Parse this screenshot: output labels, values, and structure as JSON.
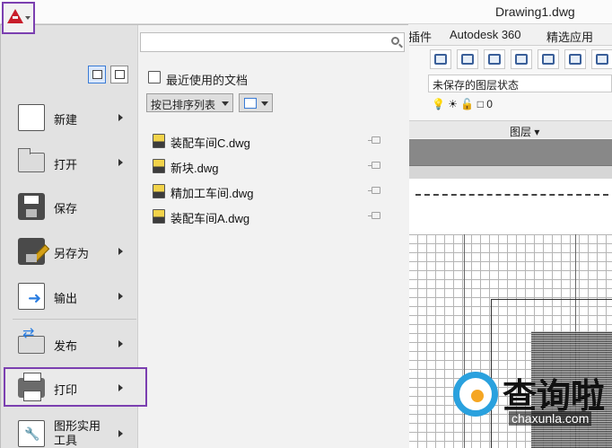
{
  "title_bar": {
    "document_title": "Drawing1.dwg",
    "app_button_icon": "autocad-logo-icon"
  },
  "ribbon": {
    "tabs": [
      "插件",
      "Autodesk 360",
      "精选应用"
    ],
    "layer_state": "未保存的图层状态",
    "layer_value": "0",
    "panel_label": "图层 ▾"
  },
  "menu": {
    "search": {
      "placeholder": ""
    },
    "items": [
      {
        "label": "新建",
        "icon": "new-document-icon",
        "arrow": true
      },
      {
        "label": "打开",
        "icon": "open-folder-icon",
        "arrow": true
      },
      {
        "label": "保存",
        "icon": "save-disk-icon",
        "arrow": false
      },
      {
        "label": "另存为",
        "icon": "save-as-icon",
        "arrow": true
      },
      {
        "label": "输出",
        "icon": "export-icon",
        "arrow": true
      },
      {
        "label": "发布",
        "icon": "publish-icon",
        "arrow": true
      },
      {
        "label": "打印",
        "icon": "print-icon",
        "arrow": true,
        "selected": true
      },
      {
        "label": "图形实用工具",
        "icon": "drawing-utilities-icon",
        "arrow": true
      }
    ],
    "recent": {
      "title": "最近使用的文档",
      "sort_option": "按已排序列表",
      "files": [
        "装配车间C.dwg",
        "新块.dwg",
        "精加工车间.dwg",
        "装配车间A.dwg"
      ]
    }
  },
  "watermark": {
    "text": "查询啦",
    "url": "chaxunla.com"
  },
  "colors": {
    "highlight": "#7b3fb0",
    "logo": "#c81e2b",
    "watermark_blue": "#2aa1de"
  }
}
